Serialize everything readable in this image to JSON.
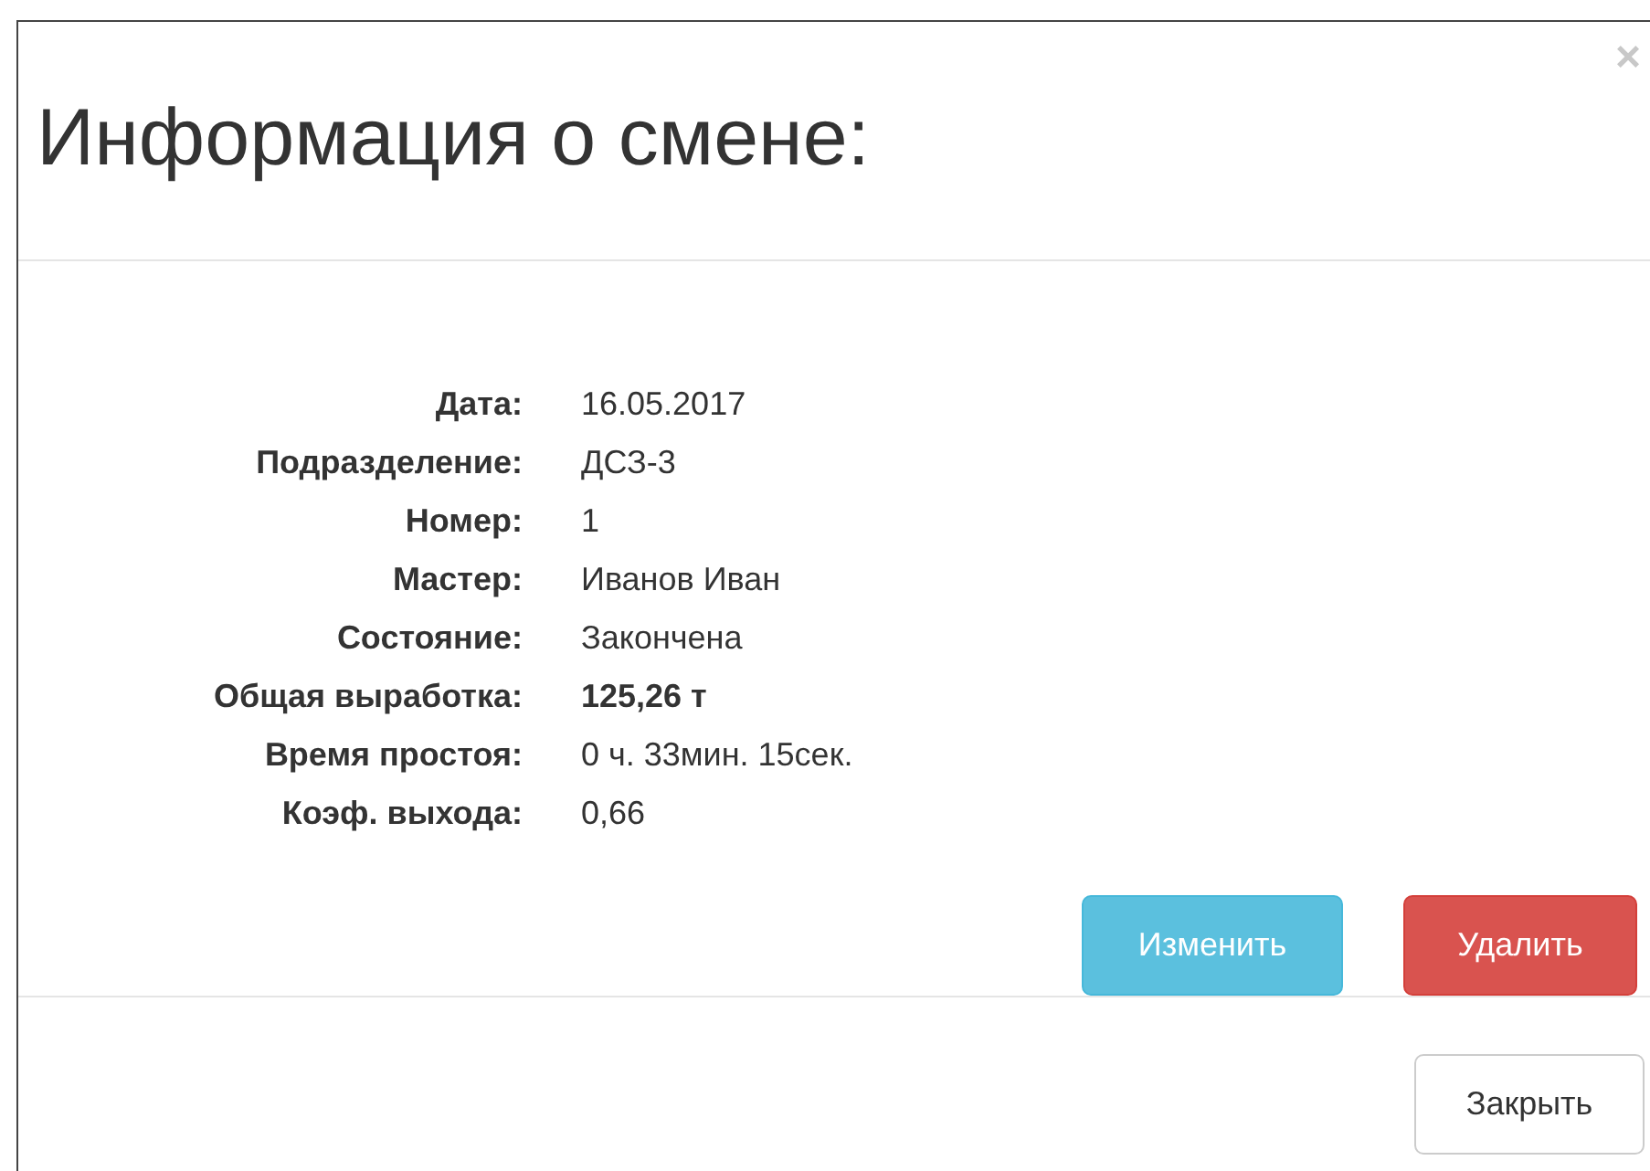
{
  "dialog": {
    "title": "Информация о смене:",
    "close_glyph": "×"
  },
  "fields": [
    {
      "label": "Дата:",
      "value": "16.05.2017",
      "bold": false
    },
    {
      "label": "Подразделение:",
      "value": "ДСЗ-3",
      "bold": false
    },
    {
      "label": "Номер:",
      "value": "1",
      "bold": false
    },
    {
      "label": "Мастер:",
      "value": "Иванов Иван",
      "bold": false
    },
    {
      "label": "Состояние:",
      "value": "Закончена",
      "bold": false
    },
    {
      "label": "Общая выработка:",
      "value": "125,26 т",
      "bold": true
    },
    {
      "label": "Время простоя:",
      "value": "0 ч. 33мин. 15сек.",
      "bold": false
    },
    {
      "label": "Коэф. выхода:",
      "value": "0,66",
      "bold": false
    }
  ],
  "actions": [
    {
      "label": "Изменить",
      "kind": "info"
    },
    {
      "label": "Удалить",
      "kind": "danger"
    }
  ],
  "footer_buttons": [
    {
      "label": "Закрыть",
      "kind": "default"
    }
  ]
}
